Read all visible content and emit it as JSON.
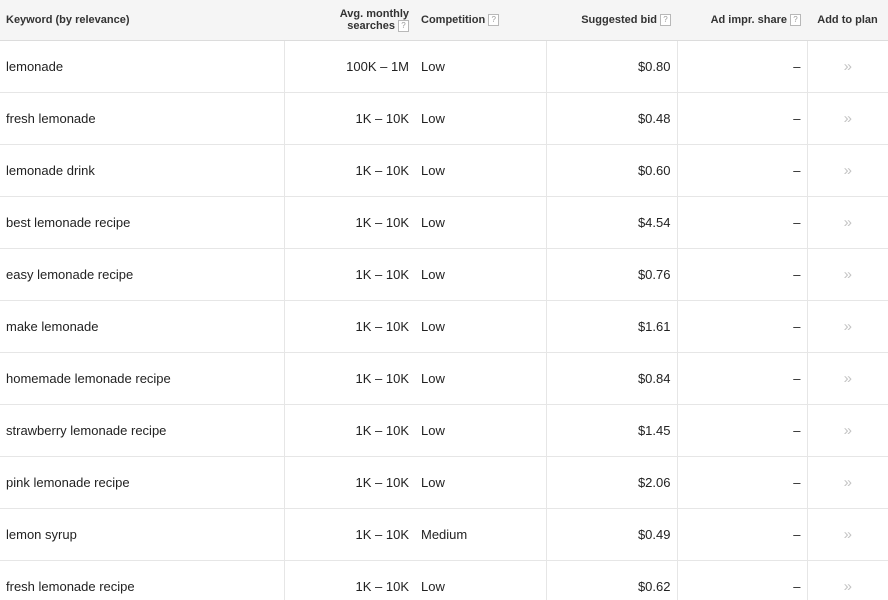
{
  "table": {
    "headers": {
      "keyword": "Keyword (by relevance)",
      "avg_line1": "Avg. monthly",
      "avg_line2": "searches",
      "competition": "Competition",
      "suggested_bid": "Suggested bid",
      "ad_impr_share": "Ad impr. share",
      "add_to_plan": "Add to plan",
      "help_glyph": "?"
    },
    "add_glyph": "»",
    "rows": [
      {
        "keyword": "lemonade",
        "searches": "100K – 1M",
        "competition": "Low",
        "bid": "$0.80",
        "share": "–"
      },
      {
        "keyword": "fresh lemonade",
        "searches": "1K – 10K",
        "competition": "Low",
        "bid": "$0.48",
        "share": "–"
      },
      {
        "keyword": "lemonade drink",
        "searches": "1K – 10K",
        "competition": "Low",
        "bid": "$0.60",
        "share": "–"
      },
      {
        "keyword": "best lemonade recipe",
        "searches": "1K – 10K",
        "competition": "Low",
        "bid": "$4.54",
        "share": "–"
      },
      {
        "keyword": "easy lemonade recipe",
        "searches": "1K – 10K",
        "competition": "Low",
        "bid": "$0.76",
        "share": "–"
      },
      {
        "keyword": "make lemonade",
        "searches": "1K – 10K",
        "competition": "Low",
        "bid": "$1.61",
        "share": "–"
      },
      {
        "keyword": "homemade lemonade recipe",
        "searches": "1K – 10K",
        "competition": "Low",
        "bid": "$0.84",
        "share": "–"
      },
      {
        "keyword": "strawberry lemonade recipe",
        "searches": "1K – 10K",
        "competition": "Low",
        "bid": "$1.45",
        "share": "–"
      },
      {
        "keyword": "pink lemonade recipe",
        "searches": "1K – 10K",
        "competition": "Low",
        "bid": "$2.06",
        "share": "–"
      },
      {
        "keyword": "lemon syrup",
        "searches": "1K – 10K",
        "competition": "Medium",
        "bid": "$0.49",
        "share": "–"
      },
      {
        "keyword": "fresh lemonade recipe",
        "searches": "1K – 10K",
        "competition": "Low",
        "bid": "$0.62",
        "share": "–"
      }
    ]
  }
}
